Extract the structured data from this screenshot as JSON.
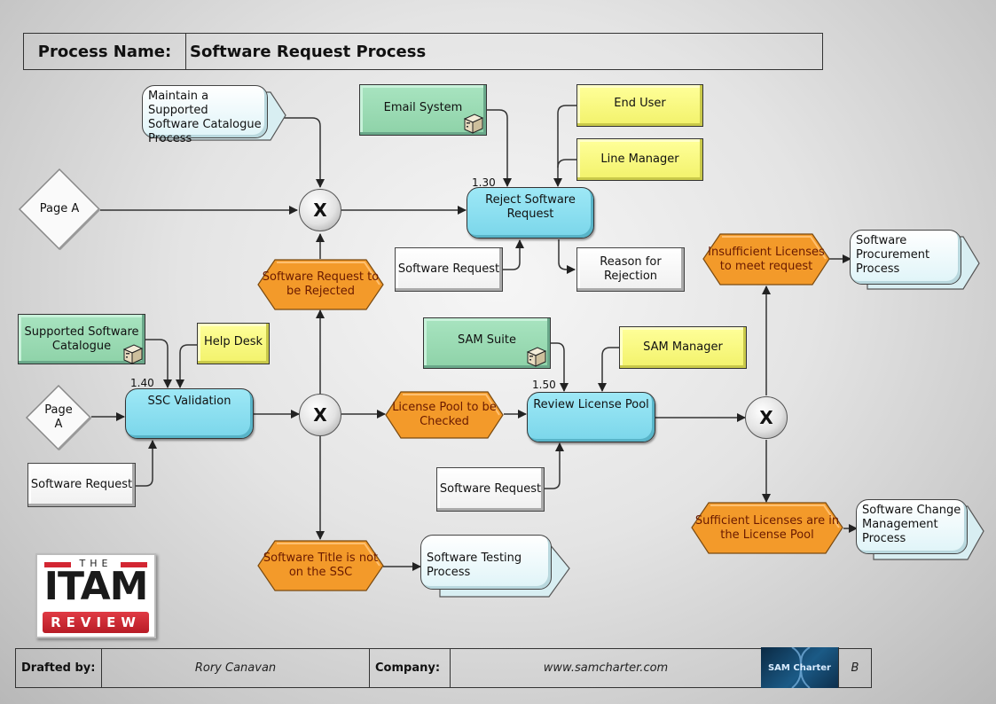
{
  "header": {
    "label": "Process Name:",
    "value": "Software Request Process"
  },
  "colors": {
    "function": "#86dcee",
    "event": "#f39a2a",
    "system": "#9edcb6",
    "org_unit": "#f8f87a",
    "info": "#ffffff",
    "process_interface": "#eef9fb",
    "connector": "#333333"
  },
  "functions": [
    {
      "id": "1.30",
      "number": "1.30",
      "label": "Reject Software Request"
    },
    {
      "id": "1.40",
      "number": "1.40",
      "label": "SSC Validation"
    },
    {
      "id": "1.50",
      "number": "1.50",
      "label": "Review License Pool"
    }
  ],
  "events": [
    {
      "label": "Software Request to be Rejected"
    },
    {
      "label": "License Pool to be Checked"
    },
    {
      "label": "Software Title is not on the SSC"
    },
    {
      "label": "Insufficient Licenses to meet request"
    },
    {
      "label": "Sufficient Licenses are in the License Pool"
    }
  ],
  "systems": [
    {
      "label": "Email System",
      "icon": "server-icon"
    },
    {
      "label": "Supported Software Catalogue",
      "icon": "server-icon"
    },
    {
      "label": "SAM Suite",
      "icon": "server-icon"
    }
  ],
  "org_units": [
    {
      "label": "End User"
    },
    {
      "label": "Line Manager"
    },
    {
      "label": "Help Desk"
    },
    {
      "label": "SAM Manager"
    }
  ],
  "info_objects": [
    {
      "label": "Software Request"
    },
    {
      "label": "Reason for Rejection"
    },
    {
      "label": "Software Request"
    },
    {
      "label": "Software Request"
    }
  ],
  "process_interfaces": [
    {
      "label": "Maintain a Supported Software Catalogue Process"
    },
    {
      "label": "Software Procurement Process"
    },
    {
      "label": "Software Testing Process"
    },
    {
      "label": "Software Change Management Process"
    }
  ],
  "connectors": [
    {
      "label": "Page A"
    },
    {
      "label": "Page A"
    }
  ],
  "gateways": [
    {
      "label": "X"
    },
    {
      "label": "X"
    },
    {
      "label": "X"
    }
  ],
  "logo": {
    "top": "THE",
    "main": "ITAM",
    "bottom": "REVIEW"
  },
  "footer": {
    "drafted_label": "Drafted by:",
    "drafted_value": "Rory Canavan",
    "company_label": "Company:",
    "company_value": "www.samcharter.com",
    "brand": "SAM Charter",
    "revision": "B"
  }
}
